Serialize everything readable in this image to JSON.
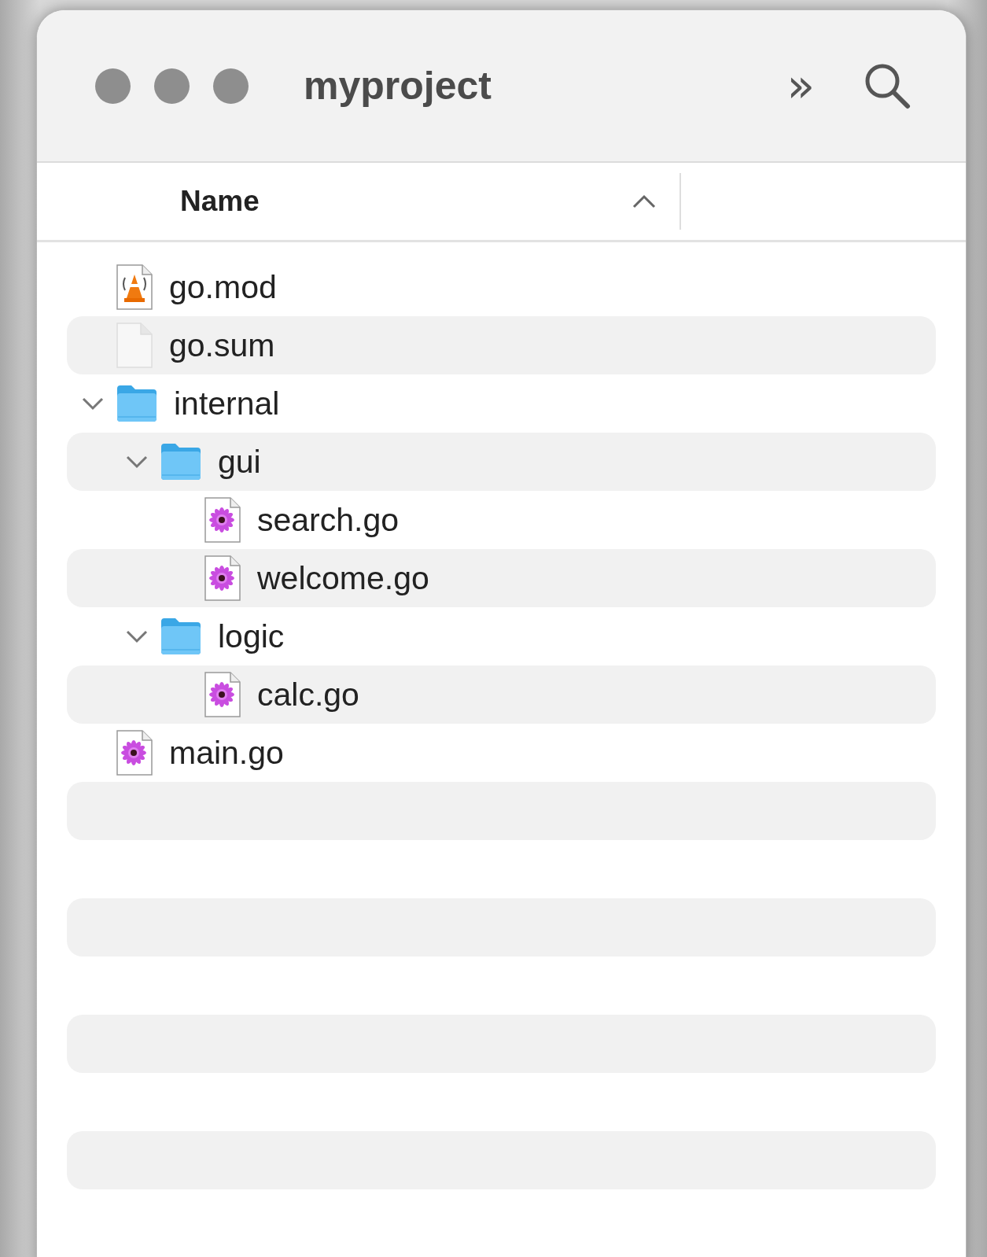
{
  "window": {
    "title": "myproject"
  },
  "toolbar": {
    "more": "»"
  },
  "columns": [
    {
      "label": "Name",
      "sort_ascending": true
    }
  ],
  "files": [
    {
      "name": "go.mod",
      "kind": "media-doc"
    },
    {
      "name": "go.sum",
      "kind": "blank-doc"
    },
    {
      "name": "internal",
      "kind": "folder",
      "expanded": true,
      "children": [
        {
          "name": "gui",
          "kind": "folder",
          "expanded": true,
          "children": [
            {
              "name": "search.go",
              "kind": "flower-doc"
            },
            {
              "name": "welcome.go",
              "kind": "flower-doc"
            }
          ]
        },
        {
          "name": "logic",
          "kind": "folder",
          "expanded": true,
          "children": [
            {
              "name": "calc.go",
              "kind": "flower-doc"
            }
          ]
        }
      ]
    },
    {
      "name": "main.go",
      "kind": "flower-doc"
    }
  ]
}
